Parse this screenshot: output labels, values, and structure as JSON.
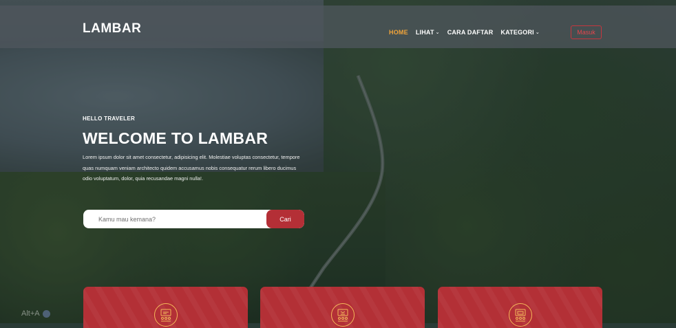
{
  "navbar": {
    "brand": "LAMBAR",
    "items": [
      {
        "label": "HOME",
        "active": true,
        "dropdown": false
      },
      {
        "label": "LIHAT",
        "active": false,
        "dropdown": true
      },
      {
        "label": "CARA DAFTAR",
        "active": false,
        "dropdown": false
      },
      {
        "label": "KATEGORI",
        "active": false,
        "dropdown": true
      }
    ],
    "login_label": "Masuk"
  },
  "hero": {
    "eyebrow": "HELLO TRAVELER",
    "title": "WELCOME TO LAMBAR",
    "text": "Lorem ipsum dolor sit amet consectetur, adipisicing elit. Molestiae voluptas consectetur, tempore quas numquam veniam architecto quidem accusamus nobis consequatur rerum libero ducimus odio voluptatum, dolor, quia recusandae magni nulla!."
  },
  "search": {
    "placeholder": "Kamu mau kemana?",
    "button_label": "Cari"
  },
  "cards": [
    {
      "icon": "destination-icon"
    },
    {
      "icon": "guide-icon"
    },
    {
      "icon": "agency-icon"
    }
  ],
  "watermark": "Alt+A",
  "colors": {
    "accent": "#b42f36",
    "active_nav": "#f2a53a",
    "icon_ring": "#f4b85a"
  }
}
